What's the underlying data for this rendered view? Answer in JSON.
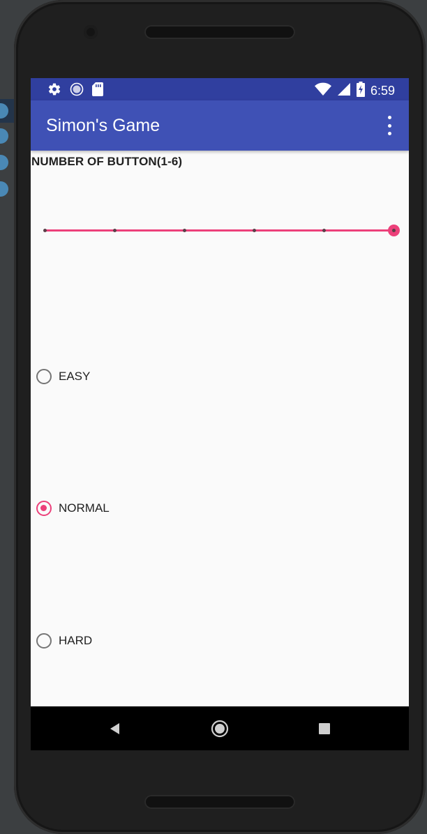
{
  "app": {
    "title": "Simon's Game"
  },
  "status_bar": {
    "time": "6:59",
    "left_icons": [
      "settings-icon",
      "sync-icon",
      "sd-card-icon"
    ],
    "right_icons": [
      "wifi-icon",
      "signal-icon",
      "battery-charging-icon"
    ]
  },
  "settings": {
    "button_count_label": "NUMBER OF BUTTON(1-6)",
    "button_count": {
      "min": 1,
      "max": 6,
      "value": 6
    },
    "difficulty": {
      "options": [
        "EASY",
        "NORMAL",
        "HARD"
      ],
      "selected": "NORMAL"
    }
  },
  "nav_bar": {
    "buttons": [
      "back-icon",
      "home-icon",
      "recents-icon"
    ]
  },
  "colors": {
    "primary": "#3f51b5",
    "primary_dark": "#303f9f",
    "accent": "#ec407a"
  }
}
